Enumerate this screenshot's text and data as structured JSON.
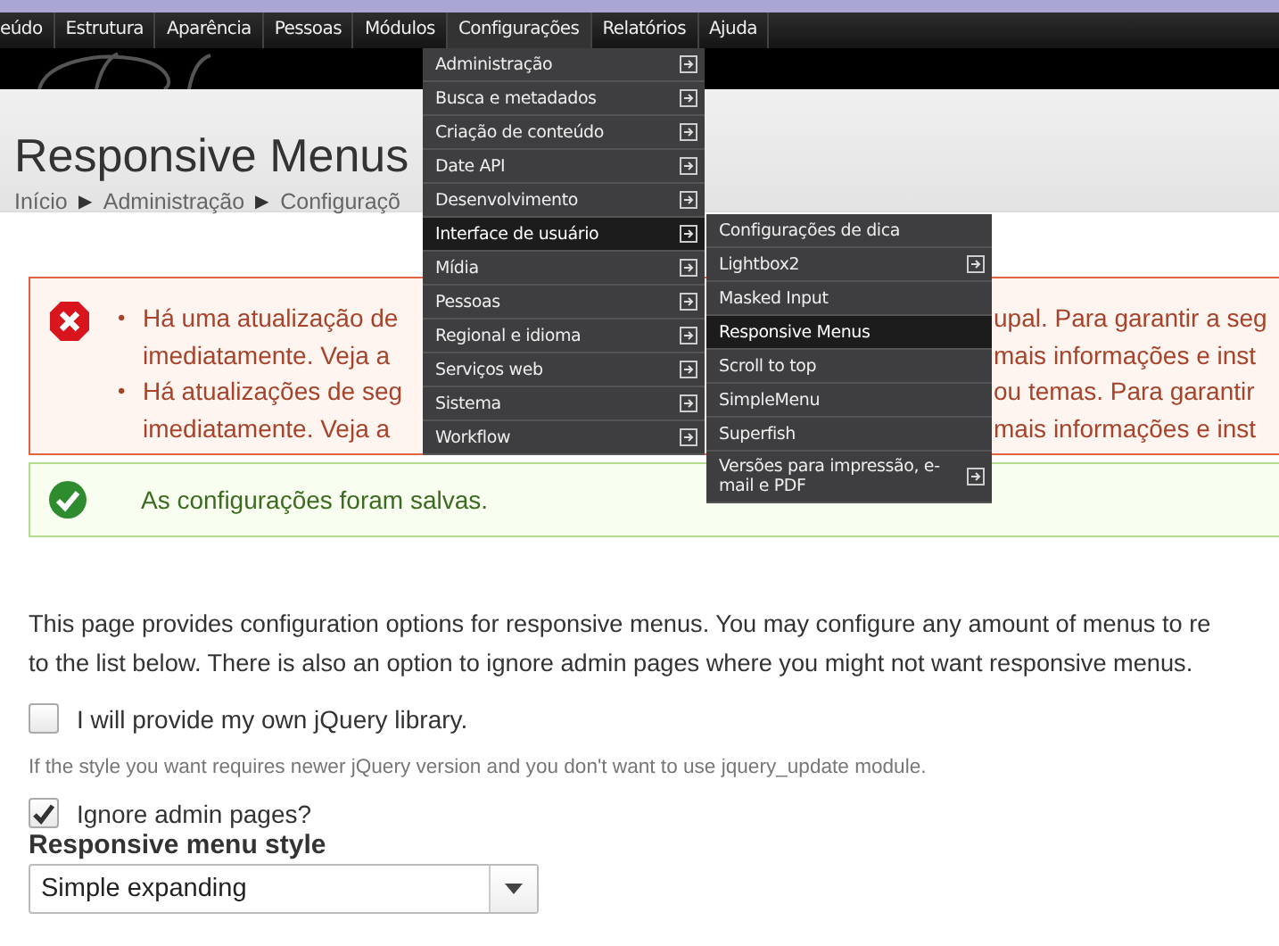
{
  "top_nav": {
    "items": [
      {
        "label": "eúdo",
        "selected": false
      },
      {
        "label": "Estrutura",
        "selected": false
      },
      {
        "label": "Aparência",
        "selected": false
      },
      {
        "label": "Pessoas",
        "selected": false
      },
      {
        "label": "Módulos",
        "selected": false
      },
      {
        "label": "Configurações",
        "selected": true
      },
      {
        "label": "Relatórios",
        "selected": false
      },
      {
        "label": "Ajuda",
        "selected": false
      }
    ]
  },
  "header": {
    "title": "Responsive Menus"
  },
  "breadcrumb": {
    "separator": "▶",
    "items": [
      "Início",
      "Administração",
      "Configuraçõ"
    ]
  },
  "menu": {
    "items": [
      {
        "label": "Administração",
        "selected": false,
        "has_submenu": true
      },
      {
        "label": "Busca e metadados",
        "selected": false,
        "has_submenu": true
      },
      {
        "label": "Criação de conteúdo",
        "selected": false,
        "has_submenu": true
      },
      {
        "label": "Date API",
        "selected": false,
        "has_submenu": true
      },
      {
        "label": "Desenvolvimento",
        "selected": false,
        "has_submenu": true
      },
      {
        "label": "Interface de usuário",
        "selected": true,
        "has_submenu": true
      },
      {
        "label": "Mídia",
        "selected": false,
        "has_submenu": true
      },
      {
        "label": "Pessoas",
        "selected": false,
        "has_submenu": true
      },
      {
        "label": "Regional e idioma",
        "selected": false,
        "has_submenu": true
      },
      {
        "label": "Serviços web",
        "selected": false,
        "has_submenu": true
      },
      {
        "label": "Sistema",
        "selected": false,
        "has_submenu": true
      },
      {
        "label": "Workflow",
        "selected": false,
        "has_submenu": true
      }
    ]
  },
  "submenu": {
    "items": [
      {
        "label": "Configurações de dica",
        "selected": false,
        "has_submenu": false
      },
      {
        "label": "Lightbox2",
        "selected": false,
        "has_submenu": true
      },
      {
        "label": "Masked Input",
        "selected": false,
        "has_submenu": false
      },
      {
        "label": "Responsive Menus",
        "selected": true,
        "has_submenu": false
      },
      {
        "label": "Scroll to top",
        "selected": false,
        "has_submenu": false
      },
      {
        "label": "SimpleMenu",
        "selected": false,
        "has_submenu": false
      },
      {
        "label": "Superfish",
        "selected": false,
        "has_submenu": false
      },
      {
        "label": "Versões para impressão, e-mail e PDF",
        "selected": false,
        "has_submenu": true
      }
    ]
  },
  "messages": [
    {
      "kind": "error",
      "items": [
        {
          "bullet": "•",
          "lines": [
            {
              "left": "Há uma atualização de",
              "right": "upal. Para garantir a seg"
            },
            {
              "left": "imediatamente. Veja a",
              "right": "mais informações e inst"
            }
          ]
        },
        {
          "bullet": "•",
          "lines": [
            {
              "left": "Há atualizações de seg",
              "right": "ou temas. Para garantir"
            },
            {
              "left": "imediatamente. Veja a",
              "right": "mais informações e inst"
            }
          ]
        }
      ]
    },
    {
      "kind": "status",
      "text": "As configurações foram salvas."
    }
  ],
  "intro": [
    "This page provides configuration options for responsive menus. You may configure any amount of menus to re",
    "to the list below. There is also an option to ignore admin pages where you might not want responsive menus."
  ],
  "checkboxes": [
    {
      "label": "I will provide my own jQuery library.",
      "checked": false,
      "description": "If the style you want requires newer jQuery version and you don't want to use jquery_update module."
    },
    {
      "label": "Ignore admin pages?",
      "checked": true
    }
  ],
  "style_select": {
    "label": "Responsive menu style",
    "value": "Simple expanding"
  }
}
